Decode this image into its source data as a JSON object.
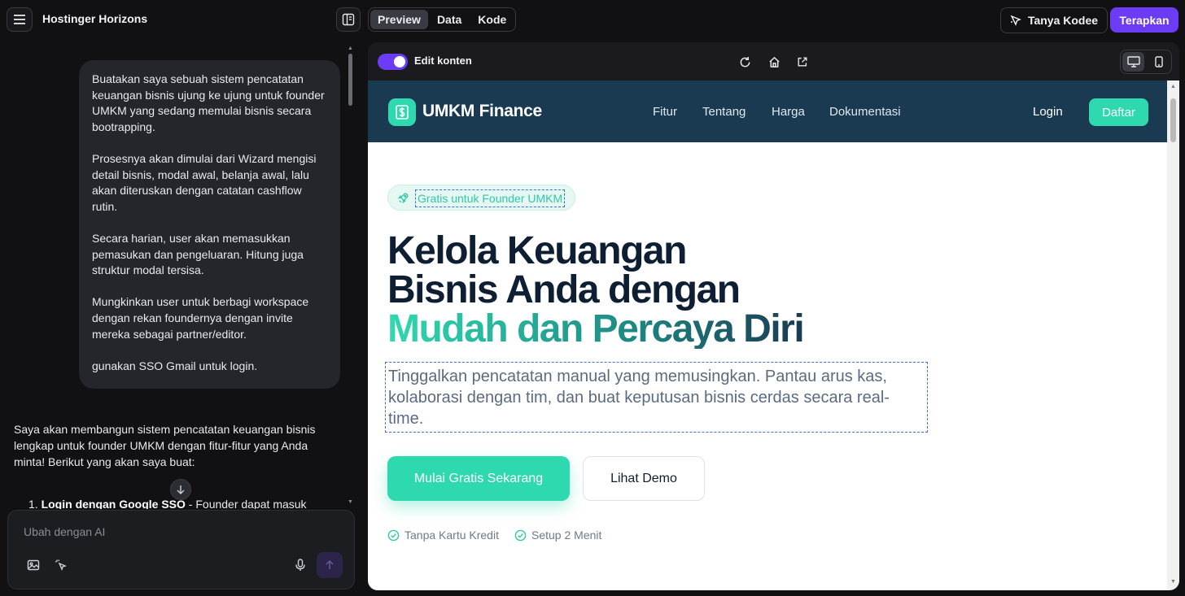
{
  "header": {
    "app_title": "Hostinger Horizons",
    "tabs": [
      {
        "label": "Preview",
        "active": true
      },
      {
        "label": "Data",
        "active": false
      },
      {
        "label": "Kode",
        "active": false
      }
    ],
    "ask_kodee_label": "Tanya Kodee",
    "apply_label": "Terapkan"
  },
  "chat": {
    "user_message": "Buatakan saya sebuah sistem pencatatan keuangan bisnis ujung ke ujung untuk founder UMKM yang sedang memulai bisnis secara bootrapping.\n\nProsesnya akan dimulai dari Wizard mengisi detail bisnis, modal awal, belanja awal, lalu akan diteruskan dengan catatan cashflow rutin.\n\nSecara harian, user akan memasukkan pemasukan dan pengeluaran. Hitung juga struktur modal tersisa.\n\nMungkinkan user untuk berbagi workspace dengan rekan foundernya dengan invite mereka sebagai partner/editor.\n\ngunakan SSO Gmail untuk login.",
    "ai_intro": "Saya akan membangun sistem pencatatan keuangan bisnis lengkap untuk founder UMKM dengan fitur-fitur yang Anda minta! Berikut yang akan saya buat:",
    "ai_list_item_1_title": "Login dengan Google SSO",
    "ai_list_item_1_rest": " - Founder dapat masuk",
    "composer_placeholder": "Ubah dengan AI"
  },
  "preview_toolbar": {
    "edit_toggle_label": "Edit konten",
    "edit_toggle_on": true,
    "active_device": "desktop"
  },
  "site": {
    "brand": "UMKM Finance",
    "nav_links": [
      "Fitur",
      "Tentang",
      "Harga",
      "Dokumentasi"
    ],
    "login_label": "Login",
    "signup_label": "Daftar",
    "badge_text": "Gratis untuk Founder UMKM",
    "hero_line_1": "Kelola Keuangan",
    "hero_line_2": "Bisnis Anda dengan",
    "hero_line_3": "Mudah dan Percaya Diri",
    "hero_subtitle": "Tinggalkan pencatatan manual yang memusingkan. Pantau arus kas, kolaborasi dengan tim, dan buat keputusan bisnis cerdas secara real-time.",
    "cta_primary": "Mulai Gratis Sekarang",
    "cta_secondary": "Lihat Demo",
    "features": [
      "Tanpa Kartu Kredit",
      "Setup 2 Menit"
    ]
  },
  "colors": {
    "accent_purple": "#6c3cf5",
    "site_nav_bg": "#1a3a52",
    "site_teal": "#2fd9b0",
    "selection_outline": "#3b6fe0"
  },
  "icons": [
    "menu-icon",
    "panel-layout-icon",
    "kodee-sparkle-icon",
    "refresh-icon",
    "home-icon",
    "external-link-icon",
    "desktop-icon",
    "mobile-icon",
    "arrow-down-icon",
    "image-icon",
    "cursor-select-icon",
    "microphone-icon",
    "arrow-up-icon",
    "dollar-icon",
    "rocket-icon",
    "check-circle-icon"
  ]
}
